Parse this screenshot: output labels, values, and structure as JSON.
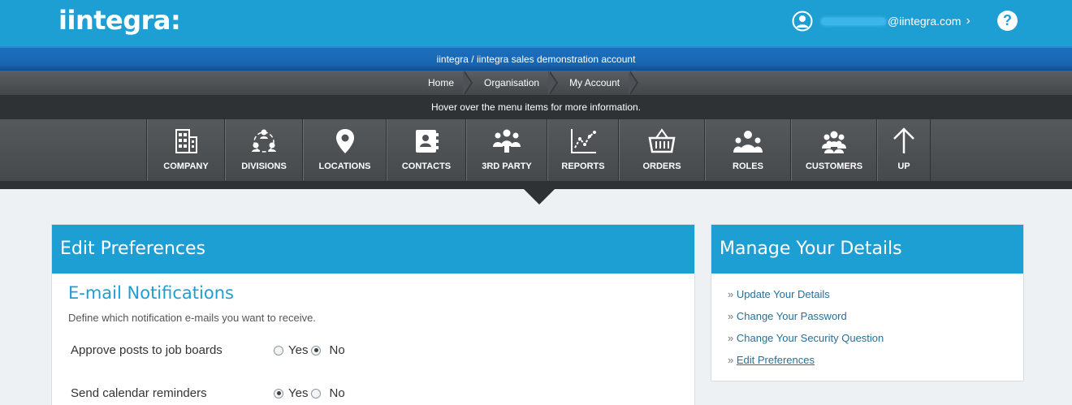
{
  "header": {
    "logo": "iintegra:",
    "user_email": "@iintegra.com",
    "user_chevron": "›",
    "help": "?"
  },
  "account": {
    "title": "iintegra / iintegra sales demonstration account"
  },
  "breadcrumb": [
    "Home",
    "Organisation",
    "My Account"
  ],
  "hint": "Hover over the menu items for more information.",
  "menu": [
    {
      "label": "COMPANY",
      "icon": "building-icon"
    },
    {
      "label": "DIVISIONS",
      "icon": "divisions-icon"
    },
    {
      "label": "LOCATIONS",
      "icon": "map-pin-icon"
    },
    {
      "label": "CONTACTS",
      "icon": "contact-book-icon"
    },
    {
      "label": "3RD PARTY",
      "icon": "third-party-icon"
    },
    {
      "label": "REPORTS",
      "icon": "chart-icon"
    },
    {
      "label": "ORDERS",
      "icon": "basket-icon"
    },
    {
      "label": "ROLES",
      "icon": "roles-icon"
    },
    {
      "label": "CUSTOMERS",
      "icon": "customers-icon"
    },
    {
      "label": "UP",
      "icon": "arrow-up-icon"
    }
  ],
  "edit_preferences": {
    "title": "Edit Preferences",
    "section_title": "E-mail Notifications",
    "section_desc": "Define which notification e-mails you want to receive.",
    "prefs": [
      {
        "label": "Approve posts to job boards",
        "yes": "Yes",
        "no": "No",
        "selected": "No"
      },
      {
        "label": "Send calendar reminders",
        "yes": "Yes",
        "no": "No",
        "selected": "Yes"
      }
    ]
  },
  "manage": {
    "title": "Manage Your Details",
    "prefix": "»",
    "links": [
      "Update Your Details",
      "Change Your Password",
      "Change Your Security Question",
      "Edit Preferences"
    ]
  },
  "colors": {
    "brand_blue": "#1e9fd4",
    "dark_bar": "#2e3235",
    "menu_bg": "#4e5256",
    "link": "#2a6f96"
  }
}
